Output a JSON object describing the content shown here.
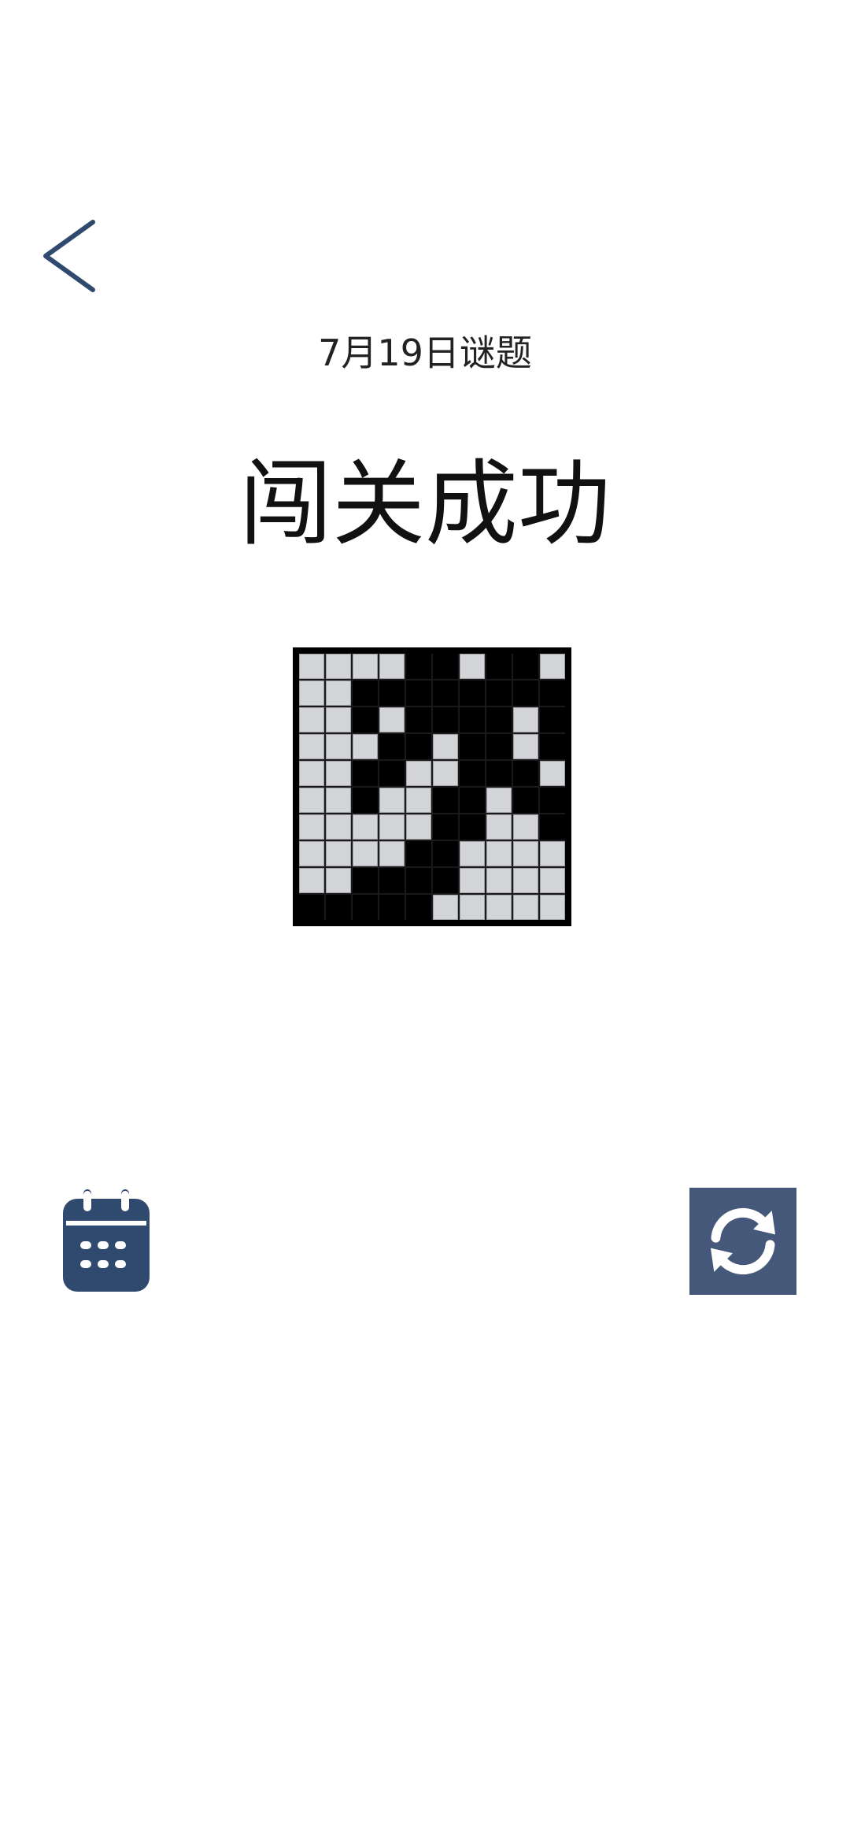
{
  "header": {
    "back_icon": "chevron-left-icon"
  },
  "puzzle": {
    "date_label": "7月19日谜题",
    "status_title": "闯关成功",
    "rows": 10,
    "cols": 10,
    "grid": [
      [
        0,
        0,
        0,
        0,
        1,
        1,
        0,
        1,
        1,
        0
      ],
      [
        0,
        0,
        1,
        1,
        1,
        1,
        1,
        1,
        1,
        1
      ],
      [
        0,
        0,
        1,
        0,
        1,
        1,
        1,
        1,
        0,
        1
      ],
      [
        0,
        0,
        0,
        1,
        1,
        0,
        1,
        1,
        0,
        1
      ],
      [
        0,
        0,
        1,
        1,
        0,
        0,
        1,
        1,
        1,
        0
      ],
      [
        0,
        0,
        1,
        0,
        0,
        1,
        1,
        0,
        1,
        1
      ],
      [
        0,
        0,
        0,
        0,
        0,
        1,
        1,
        0,
        0,
        1
      ],
      [
        0,
        0,
        0,
        0,
        1,
        1,
        0,
        0,
        0,
        0
      ],
      [
        0,
        0,
        1,
        1,
        1,
        1,
        0,
        0,
        0,
        0
      ],
      [
        1,
        1,
        1,
        1,
        1,
        0,
        0,
        0,
        0,
        0
      ]
    ]
  },
  "actions": {
    "calendar_icon": "calendar-icon",
    "refresh_icon": "refresh-icon"
  },
  "colors": {
    "accent": "#2f4a6e",
    "refresh_bg": "#45587a",
    "cell_empty": "#d3d4d8",
    "cell_filled": "#000000"
  }
}
